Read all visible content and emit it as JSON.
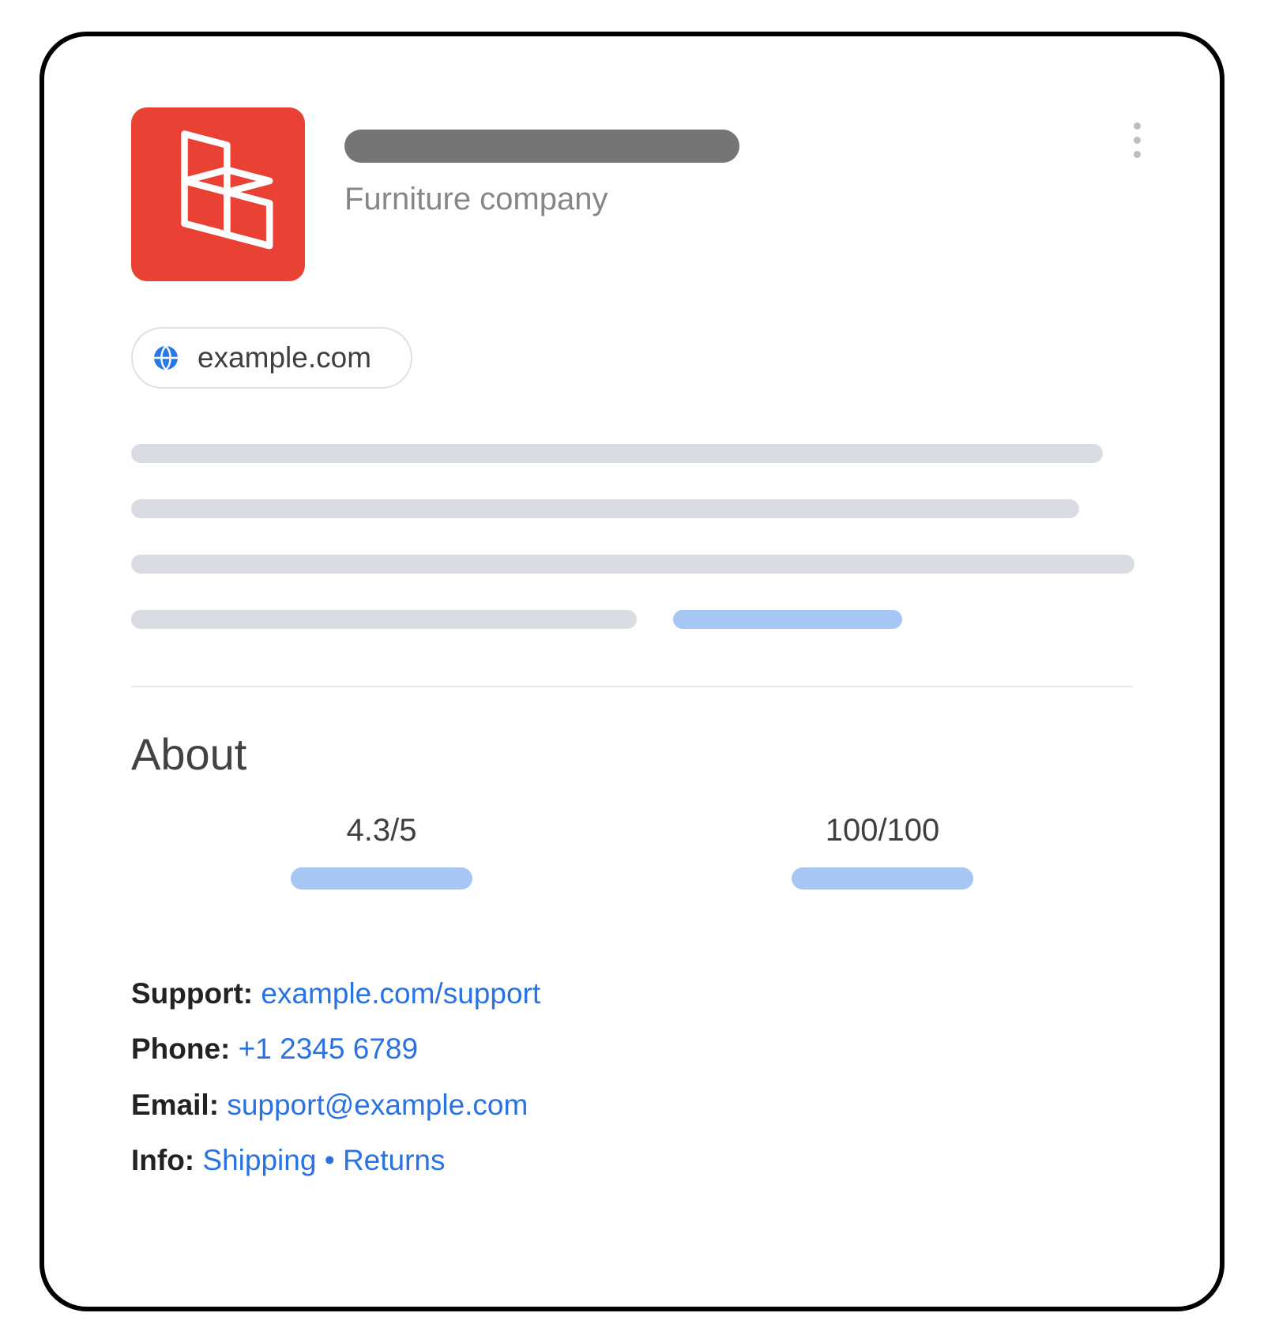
{
  "header": {
    "subtitle": "Furniture company",
    "more_menu_label": "More options"
  },
  "domain_chip": {
    "text": "example.com"
  },
  "about": {
    "heading": "About",
    "rating1": "4.3/5",
    "rating2": "100/100"
  },
  "contacts": {
    "support_label": "Support:",
    "support_link": "example.com/support",
    "phone_label": "Phone:",
    "phone_link": "+1 2345 6789",
    "email_label": "Email:",
    "email_link": "support@example.com",
    "info_label": "Info:",
    "info_link1": "Shipping",
    "info_sep": "•",
    "info_link2": "Returns"
  }
}
